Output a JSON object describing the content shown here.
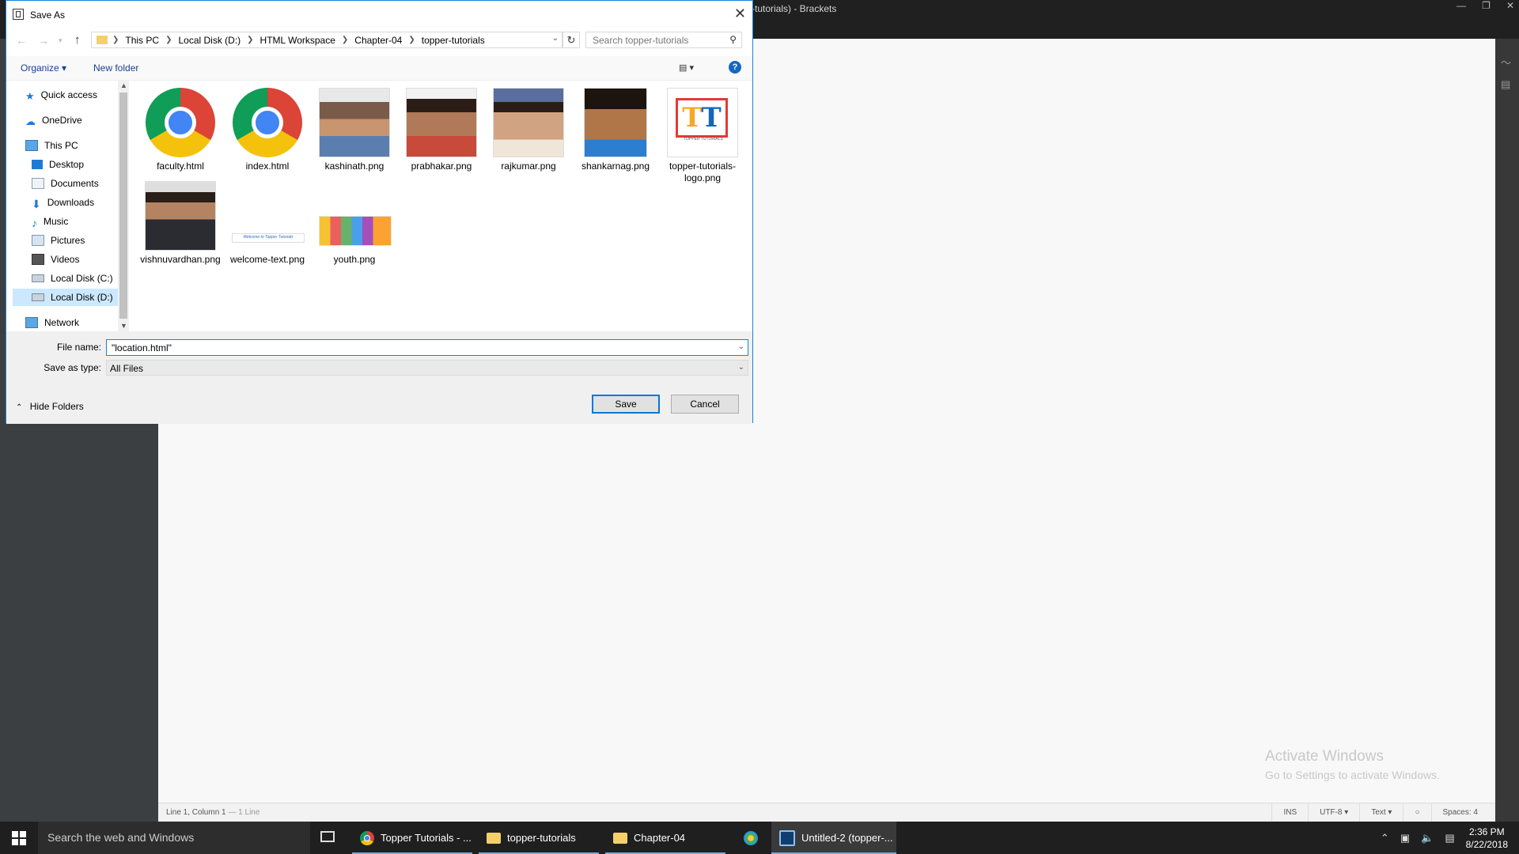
{
  "brackets": {
    "title": "-tutorials) - Brackets",
    "status_cursor": "Line 1, Column 1",
    "status_lines": "— 1 Line",
    "status_ins": "INS",
    "status_encoding": "UTF-8",
    "status_mode": "Text",
    "status_spaces": "Spaces: 4",
    "activate_line1": "Activate Windows",
    "activate_line2": "Go to Settings to activate Windows."
  },
  "dialog": {
    "title": "Save As",
    "breadcrumbs": [
      "This PC",
      "Local Disk (D:)",
      "HTML Workspace",
      "Chapter-04",
      "topper-tutorials"
    ],
    "search_placeholder": "Search topper-tutorials",
    "organize_label": "Organize",
    "new_folder_label": "New folder",
    "nav_items": [
      {
        "label": "Quick access",
        "icon": "star-icon"
      },
      {
        "label": "OneDrive",
        "icon": "cloud-icon"
      },
      {
        "label": "This PC",
        "icon": "computer-icon"
      },
      {
        "label": "Desktop",
        "icon": "desktop-icon"
      },
      {
        "label": "Documents",
        "icon": "documents-icon"
      },
      {
        "label": "Downloads",
        "icon": "download-icon"
      },
      {
        "label": "Music",
        "icon": "music-icon"
      },
      {
        "label": "Pictures",
        "icon": "pictures-icon"
      },
      {
        "label": "Videos",
        "icon": "videos-icon"
      },
      {
        "label": "Local Disk (C:)",
        "icon": "drive-icon"
      },
      {
        "label": "Local Disk (D:)",
        "icon": "drive-icon"
      },
      {
        "label": "Network",
        "icon": "network-icon"
      }
    ],
    "files": [
      {
        "name": "faculty.html",
        "kind": "chrome"
      },
      {
        "name": "index.html",
        "kind": "chrome"
      },
      {
        "name": "kashinath.png",
        "kind": "photo"
      },
      {
        "name": "prabhakar.png",
        "kind": "photo"
      },
      {
        "name": "rajkumar.png",
        "kind": "photo"
      },
      {
        "name": "shankarnag.png",
        "kind": "photo"
      },
      {
        "name": "topper-tutorials-logo.png",
        "kind": "logo"
      },
      {
        "name": "vishnuvardhan.png",
        "kind": "photo"
      },
      {
        "name": "welcome-text.png",
        "kind": "banner"
      },
      {
        "name": "youth.png",
        "kind": "youth"
      }
    ],
    "logo_text": "TOPPER TUTORIALS",
    "banner_text": "Welcome to Topper Tutorials",
    "file_name_label": "File name:",
    "file_name_value": "\"location.html\"",
    "save_type_label": "Save as type:",
    "save_type_value": "All Files",
    "hide_folders_label": "Hide Folders",
    "save_label": "Save",
    "cancel_label": "Cancel"
  },
  "taskbar": {
    "search_placeholder": "Search the web and Windows",
    "items": [
      {
        "label": "Topper Tutorials - ...",
        "icon": "chrome-icon"
      },
      {
        "label": "topper-tutorials",
        "icon": "folder-icon"
      },
      {
        "label": "Chapter-04",
        "icon": "folder-icon"
      },
      {
        "label": "Untitled-2 (topper-...",
        "icon": "brackets-icon"
      }
    ],
    "time": "2:36 PM",
    "date": "8/22/2018"
  }
}
